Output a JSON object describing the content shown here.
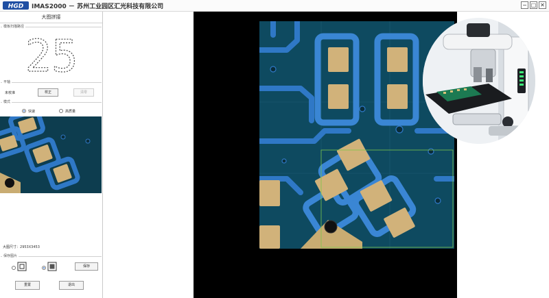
{
  "window": {
    "title": "IMAS2000 － 苏州工业园区汇光科技有限公司",
    "logo_text": "HGD",
    "buttons": [
      "−",
      "□",
      "✕"
    ]
  },
  "panel": {
    "title": "大图拼接",
    "scan_group_label": "模板扫描路径",
    "scan_path_digits": "25",
    "axis_group_label": "平轴",
    "axis_status": "未校准",
    "calibrate_button": "校正",
    "reset_button": "清零",
    "mode_group_label": "模式",
    "mode_fast": "快速",
    "mode_hd": "高质量",
    "image_size_label": "大图尺寸：",
    "image_size_value": "2953X3453",
    "save_group_label": "保存图片",
    "save_button": "保存",
    "reset_all_button": "重置",
    "exit_button": "退出"
  },
  "colors": {
    "board": "#0f4b62",
    "trace": "#2f78c6",
    "pad": "#d1b27a",
    "canvas": "#000000"
  }
}
